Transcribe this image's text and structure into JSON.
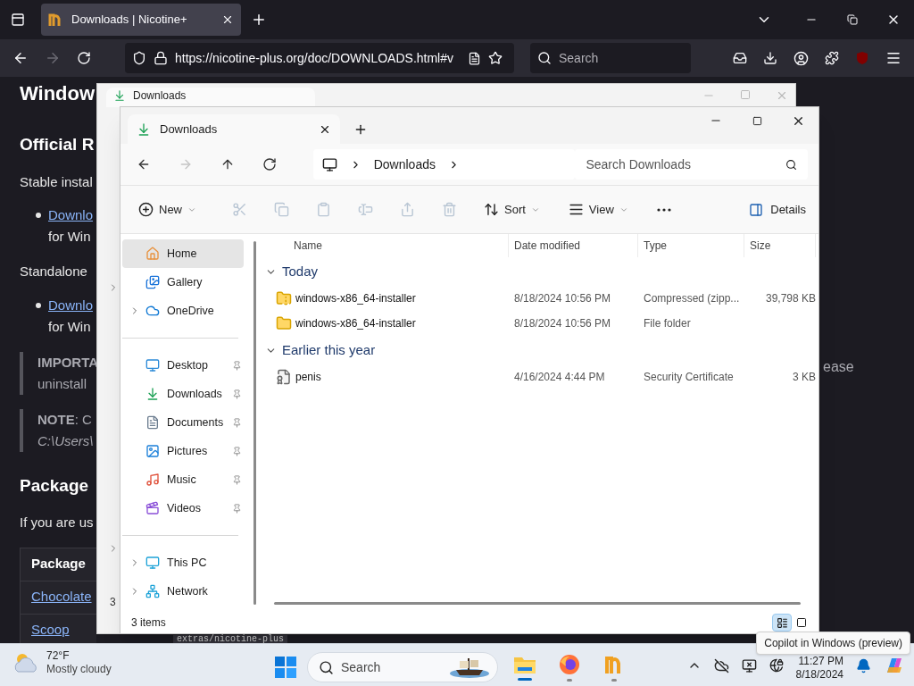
{
  "browser": {
    "tabs": [
      {
        "title": "Downloads | Nicotine+",
        "selected": true
      }
    ],
    "url": "https://nicotine-plus.org/doc/DOWNLOADS.html#v",
    "search_placeholder": "Search"
  },
  "page": {
    "blocks": [
      {
        "kind": "h1",
        "text": "Window"
      },
      {
        "kind": "h2",
        "text": "Official R"
      },
      {
        "kind": "p",
        "text": "Stable instal"
      },
      {
        "kind": "bullet",
        "link": "Downlo",
        "text": "for Win"
      },
      {
        "kind": "p",
        "text": "Standalone"
      },
      {
        "kind": "bullet",
        "link": "Downlo",
        "text": "for Win"
      },
      {
        "kind": "quote",
        "lines": [
          "**IMPORTA**",
          "uninstall"
        ]
      },
      {
        "kind": "quote",
        "lines": [
          "**NOTE**: C",
          "*C:\\Users\\*"
        ]
      },
      {
        "kind": "h2",
        "text": "Package"
      },
      {
        "kind": "p",
        "text": "If you are us"
      },
      {
        "kind": "table",
        "header": "Package",
        "rows": [
          "Chocolate",
          "Scoop"
        ]
      }
    ],
    "fragment": "ease",
    "code": "extras/nicotine-plus"
  },
  "back_window": {
    "tab": "Downloads",
    "status": "3"
  },
  "explorer": {
    "tabs": [
      {
        "title": "Downloads",
        "selected": true
      }
    ],
    "breadcrumb": [
      "Downloads"
    ],
    "search_placeholder": "Search Downloads",
    "nav": [
      {
        "kind": "back",
        "disabled": false
      },
      {
        "kind": "forward",
        "disabled": true
      },
      {
        "kind": "up",
        "disabled": false
      },
      {
        "kind": "refresh",
        "disabled": false
      }
    ],
    "toolbar": [
      {
        "kind": "new",
        "label": "New",
        "disabled": false
      },
      {
        "kind": "cut",
        "disabled": true
      },
      {
        "kind": "copy",
        "disabled": true
      },
      {
        "kind": "paste",
        "disabled": true
      },
      {
        "kind": "rename",
        "disabled": true
      },
      {
        "kind": "share",
        "disabled": true
      },
      {
        "kind": "delete",
        "disabled": true
      },
      {
        "kind": "sort",
        "label": "Sort",
        "disabled": false
      },
      {
        "kind": "view",
        "label": "View",
        "disabled": false
      },
      {
        "kind": "more",
        "disabled": false
      }
    ],
    "details_button": "Details",
    "sidebar": {
      "groups": [
        [
          {
            "label": "Home",
            "selected": true,
            "expandable": false,
            "pinned": false
          },
          {
            "label": "Gallery",
            "selected": false,
            "expandable": false,
            "pinned": false
          },
          {
            "label": "OneDrive",
            "selected": false,
            "expandable": true,
            "pinned": false
          }
        ],
        [
          {
            "label": "Desktop",
            "selected": false,
            "expandable": false,
            "pinned": true
          },
          {
            "label": "Downloads",
            "selected": false,
            "expandable": false,
            "pinned": true
          },
          {
            "label": "Documents",
            "selected": false,
            "expandable": false,
            "pinned": true
          },
          {
            "label": "Pictures",
            "selected": false,
            "expandable": false,
            "pinned": true
          },
          {
            "label": "Music",
            "selected": false,
            "expandable": false,
            "pinned": true
          },
          {
            "label": "Videos",
            "selected": false,
            "expandable": false,
            "pinned": true
          }
        ],
        [
          {
            "label": "This PC",
            "selected": false,
            "expandable": true,
            "pinned": false
          },
          {
            "label": "Network",
            "selected": false,
            "expandable": true,
            "pinned": false
          }
        ]
      ]
    },
    "columns": [
      "Name",
      "Date modified",
      "Type",
      "Size"
    ],
    "groups": [
      {
        "label": "Today",
        "expanded": true,
        "rows": [
          {
            "kind": "zip",
            "name": "windows-x86_64-installer",
            "date": "8/18/2024 10:56 PM",
            "type": "Compressed (zipp...",
            "size": "39,798 KB"
          },
          {
            "kind": "folder",
            "name": "windows-x86_64-installer",
            "date": "8/18/2024 10:56 PM",
            "type": "File folder"
          }
        ]
      },
      {
        "label": "Earlier this year",
        "expanded": true,
        "rows": [
          {
            "kind": "certificate",
            "name": "penis",
            "date": "4/16/2024 4:44 PM",
            "type": "Security Certificate",
            "size": "3 KB"
          }
        ]
      }
    ],
    "status": "3 items",
    "views": [
      {
        "kind": "details",
        "selected": true
      },
      {
        "kind": "tiles",
        "selected": false
      }
    ]
  },
  "taskbar": {
    "weather": {
      "temp": "72°F",
      "condition": "Mostly cloudy"
    },
    "search_placeholder": "Search",
    "apps": [
      {
        "kind": "explorer",
        "active": true
      },
      {
        "kind": "firefox",
        "active": false
      },
      {
        "kind": "nicotine",
        "active": false
      }
    ],
    "time": "11:27 PM",
    "date": "8/18/2024",
    "tooltip": "Copilot in Windows (preview)"
  }
}
